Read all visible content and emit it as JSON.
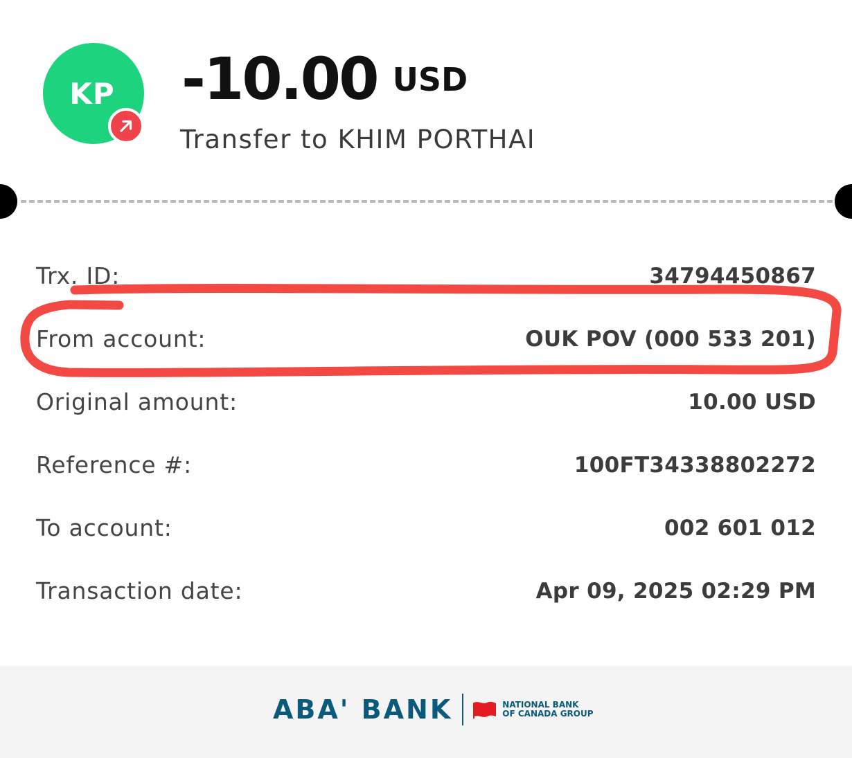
{
  "header": {
    "avatar_initials": "KP",
    "avatar_color": "#1ed37e",
    "badge_color": "#f0424a",
    "badge_icon": "arrow-up-right-icon",
    "amount": "-10.00",
    "currency": "USD",
    "description": "Transfer to KHIM PORTHAI"
  },
  "details": [
    {
      "label": "Trx. ID:",
      "value": "34794450867"
    },
    {
      "label": "From account:",
      "value": "OUK POV (000 533 201)"
    },
    {
      "label": "Original amount:",
      "value": "10.00 USD"
    },
    {
      "label": "Reference #:",
      "value": "100FT34338802272"
    },
    {
      "label": "To account:",
      "value": "002 601 012"
    },
    {
      "label": "Transaction date:",
      "value": "Apr 09, 2025 02:29 PM"
    }
  ],
  "footer": {
    "bank_name": "ABA' BANK",
    "group_line_1": "NATIONAL BANK",
    "group_line_2": "OF CANADA GROUP",
    "brand_color": "#0b5a7c",
    "flag_color": "#e31b23"
  },
  "annotation": {
    "highlight_color": "#f24a42",
    "highlighted_row": "From account:"
  }
}
